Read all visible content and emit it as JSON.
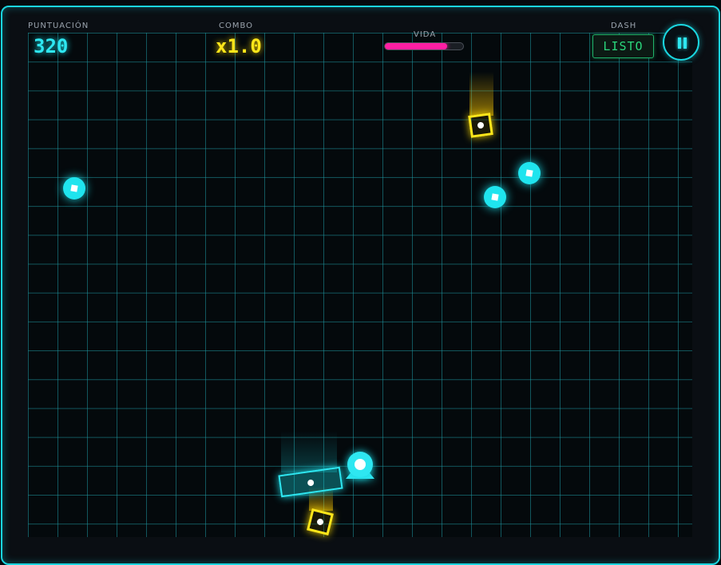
{
  "hud": {
    "score_label": "PUNTUACIÓN",
    "score_value": "320",
    "combo_label": "COMBO",
    "combo_value": "x1.0",
    "life_label": "VIDA",
    "life_fraction": 0.8,
    "dash_label": "DASH",
    "dash_status": "LISTO",
    "pause_icon": "pause-icon"
  },
  "colors": {
    "accent_cyan": "#1ad6e0",
    "combo_yellow": "#ffe61a",
    "life_pink": "#ff1fa3",
    "dash_green": "#2ad77c"
  },
  "entities": {
    "cyan_orbs": 3,
    "yellow_cubes": 2,
    "paddle": "cyan-paddle",
    "player": "player-ship"
  }
}
